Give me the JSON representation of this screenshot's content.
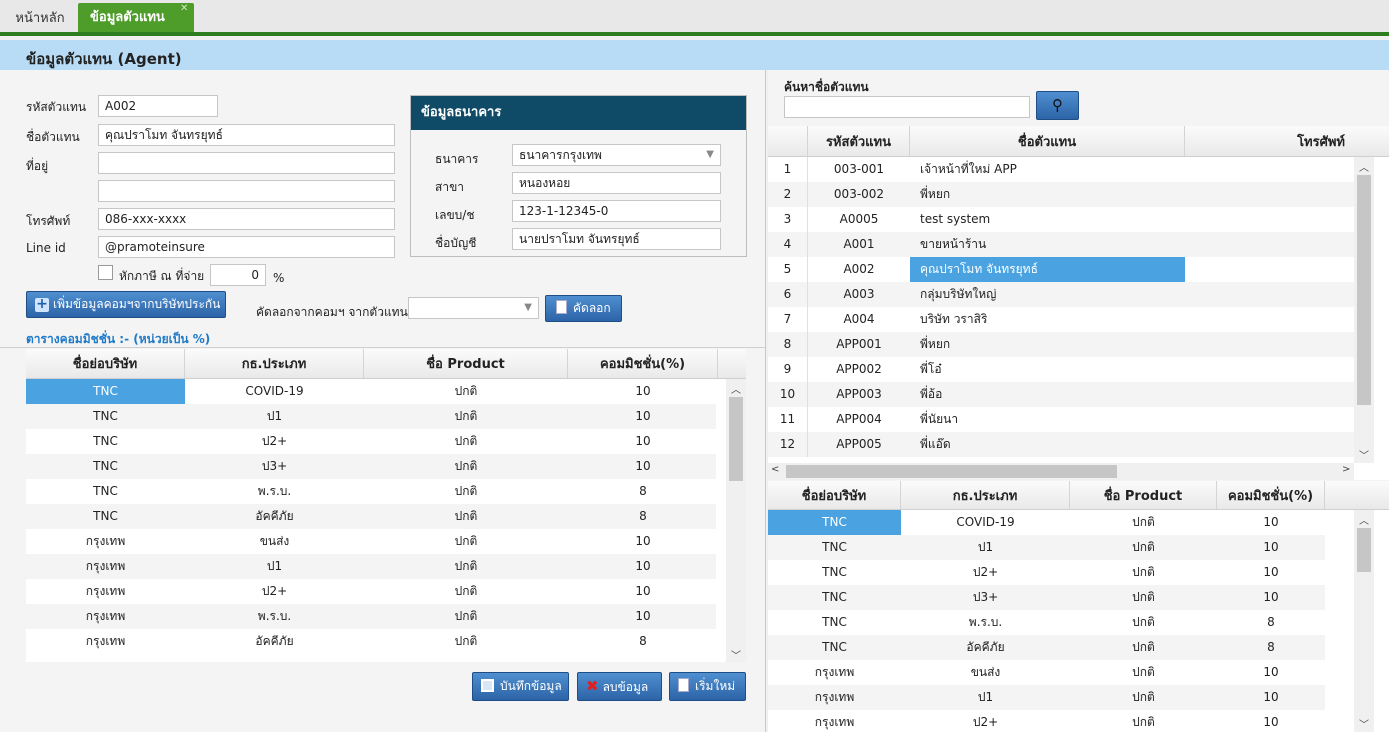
{
  "tabs": [
    {
      "label": "หน้าหลัก"
    },
    {
      "label": "ข้อมูลตัวแทน"
    }
  ],
  "page_title": "ข้อมูลตัวแทน (Agent)",
  "form": {
    "agent_code_label": "รหัสตัวแทน",
    "agent_code_value": "A002",
    "agent_name_label": "ชื่อตัวแทน",
    "agent_name_value": "คุณปราโมท จันทรยุทธ์",
    "address_label": "ที่อยู่",
    "address_line1": "",
    "address_line2": "",
    "phone_label": "โทรศัพท์",
    "phone_value": "086-xxx-xxxx",
    "line_label": "Line id",
    "line_value": "@pramoteinsure",
    "withholding_label": "หักภาษี ณ ที่จ่าย",
    "withholding_value": "0",
    "withholding_unit": "%"
  },
  "bank": {
    "title": "ข้อมูลธนาคาร",
    "bank_label": "ธนาคาร",
    "bank_value": "ธนาคารกรุงเทพ",
    "branch_label": "สาขา",
    "branch_value": "หนองหอย",
    "account_no_label": "เลขบ/ช",
    "account_no_value": "123-1-12345-0",
    "account_name_label": "ชื่อบัญชี",
    "account_name_value": "นายปราโมท จันทรยุทธ์"
  },
  "commission_actions": {
    "add_button": "เพิ่มข้อมูลคอมฯจากบริษัทประกัน",
    "copy_label": "คัดลอกจากคอมฯ จากตัวแทน",
    "copy_select_value": "",
    "copy_button": "คัดลอก",
    "table_caption": "ตารางคอมมิชชั่น :- (หน่วยเป็น %)"
  },
  "commission_table": {
    "columns": [
      "ชื่อย่อบริษัท",
      "กธ.ประเภท",
      "ชื่อ Product",
      "คอมมิชชั่น(%)"
    ],
    "rows": [
      [
        "TNC",
        "COVID-19",
        "ปกติ",
        "10"
      ],
      [
        "TNC",
        "ป1",
        "ปกติ",
        "10"
      ],
      [
        "TNC",
        "ป2+",
        "ปกติ",
        "10"
      ],
      [
        "TNC",
        "ป3+",
        "ปกติ",
        "10"
      ],
      [
        "TNC",
        "พ.ร.บ.",
        "ปกติ",
        "8"
      ],
      [
        "TNC",
        "อัคคีภัย",
        "ปกติ",
        "8"
      ],
      [
        "กรุงเทพ",
        "ขนส่ง",
        "ปกติ",
        "10"
      ],
      [
        "กรุงเทพ",
        "ป1",
        "ปกติ",
        "10"
      ],
      [
        "กรุงเทพ",
        "ป2+",
        "ปกติ",
        "10"
      ],
      [
        "กรุงเทพ",
        "พ.ร.บ.",
        "ปกติ",
        "10"
      ],
      [
        "กรุงเทพ",
        "อัคคีภัย",
        "ปกติ",
        "8"
      ]
    ]
  },
  "bottom_buttons": {
    "save": "บันทึกข้อมูล",
    "delete": "ลบข้อมูล",
    "new": "เริ่มใหม่"
  },
  "search": {
    "label": "ค้นหาชื่อตัวแทน",
    "value": ""
  },
  "agents_table": {
    "columns": [
      "",
      "รหัสตัวแทน",
      "ชื่อตัวแทน",
      "โทรศัพท์"
    ],
    "rows": [
      [
        "1",
        "003-001",
        "เจ้าหน้าที่ใหม่ APP"
      ],
      [
        "2",
        "003-002",
        "พี่หยก"
      ],
      [
        "3",
        "A0005",
        "test system"
      ],
      [
        "4",
        "A001",
        "ขายหน้าร้าน"
      ],
      [
        "5",
        "A002",
        "คุณปราโมท จันทรยุทธ์"
      ],
      [
        "6",
        "A003",
        "กลุ่มบริษัทใหญ่"
      ],
      [
        "7",
        "A004",
        "บริษัท วราสิริ"
      ],
      [
        "8",
        "APP001",
        "พี่หยก"
      ],
      [
        "9",
        "APP002",
        "พี่โอ๋"
      ],
      [
        "10",
        "APP003",
        "พี่อ้อ"
      ],
      [
        "11",
        "APP004",
        "พี่นัยนา"
      ],
      [
        "12",
        "APP005",
        "พี่แอ๊ด"
      ]
    ]
  },
  "right_commission_table": {
    "columns": [
      "ชื่อย่อบริษัท",
      "กธ.ประเภท",
      "ชื่อ Product",
      "คอมมิชชั่น(%)"
    ],
    "rows": [
      [
        "TNC",
        "COVID-19",
        "ปกติ",
        "10"
      ],
      [
        "TNC",
        "ป1",
        "ปกติ",
        "10"
      ],
      [
        "TNC",
        "ป2+",
        "ปกติ",
        "10"
      ],
      [
        "TNC",
        "ป3+",
        "ปกติ",
        "10"
      ],
      [
        "TNC",
        "พ.ร.บ.",
        "ปกติ",
        "8"
      ],
      [
        "TNC",
        "อัคคีภัย",
        "ปกติ",
        "8"
      ],
      [
        "กรุงเทพ",
        "ขนส่ง",
        "ปกติ",
        "10"
      ],
      [
        "กรุงเทพ",
        "ป1",
        "ปกติ",
        "10"
      ],
      [
        "กรุงเทพ",
        "ป2+",
        "ปกติ",
        "10"
      ]
    ]
  },
  "colors": {
    "tab_active": "#4e9c2a",
    "title_bar": "#b8dcf6",
    "bank_header": "#0f4a66",
    "selection": "#4aa3e0",
    "button": "#2c64a8"
  }
}
